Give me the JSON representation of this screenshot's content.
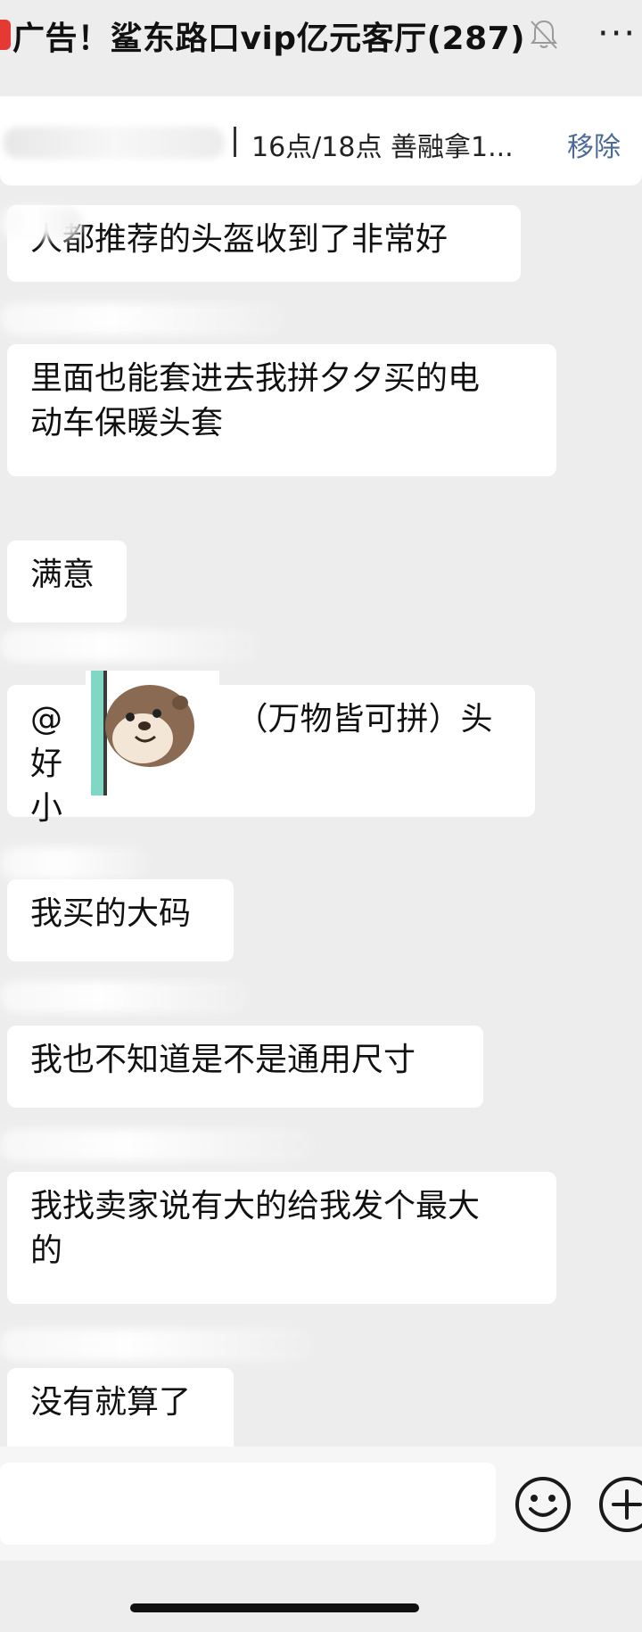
{
  "header": {
    "title": "广告！鲨东路口vip亿元客厅(287)",
    "mute_icon": "bell-muted-icon",
    "more_icon": "more-dots-icon",
    "more_glyph": "···"
  },
  "pinned": {
    "text": "16点/18点 善融拿1...",
    "remove_label": "移除"
  },
  "messages": [
    {
      "text": "人都推荐的头盔收到了非常好"
    },
    {
      "text": "里面也能套进去我拼夕夕买的电\n动车保暖头套"
    },
    {
      "text": "满意"
    },
    {
      "text": "@                 （万物皆可拼）头好\n小"
    },
    {
      "text": "我买的大码"
    },
    {
      "text": "我也不知道是不是通用尺寸"
    },
    {
      "text": "我找卖家说有大的给我发个最大\n的"
    },
    {
      "text": "没有就算了"
    }
  ],
  "sticker": {
    "icon": "otter-peek-sticker-icon"
  },
  "input": {
    "value": "",
    "emoji_icon": "emoji-icon",
    "plus_icon": "plus-icon"
  },
  "colors": {
    "background": "#ededed",
    "bubble": "#ffffff",
    "link": "#4b6a98",
    "badge": "#e53935"
  }
}
